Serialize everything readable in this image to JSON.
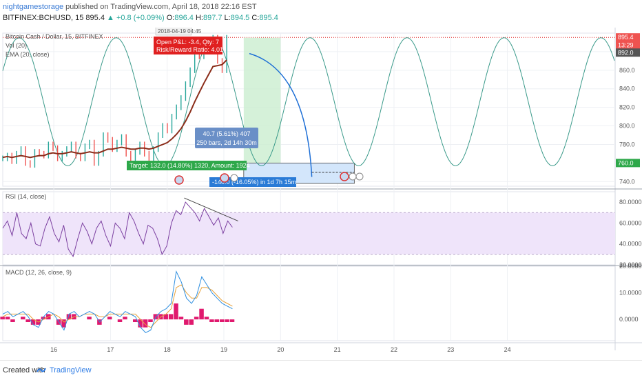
{
  "header": {
    "author": "nightgamestorage",
    "published_text": "published on TradingView.com, April 18, 2018 22:16 EST",
    "symbol": "BITFINEX:BCHUSD, 15",
    "last": "895.4",
    "change": "▲ +0.8 (+0.09%)",
    "o_label": "O:",
    "o_value": "896.4",
    "h_label": "H:",
    "h_value": "897.7",
    "l_label": "L:",
    "l_value": "894.5",
    "c_label": "C:",
    "c_value": "895.4"
  },
  "footer": {
    "created_with": "Created with",
    "brand": "TradingView"
  },
  "chart_data": {
    "type": "line",
    "colors": {
      "ema": "#8b2d1a",
      "price_up": "#26a69a",
      "price_down": "#ef5350",
      "sine": "#3a9a8a",
      "arc": "#1e6fd6",
      "rsi": "#7b3fa0",
      "rsi_band": "#efe4fa",
      "macd": "#2f8fe0",
      "signal": "#e8a23a",
      "hist": "#e0196e",
      "target": "#2ea84a",
      "stop_blue": "#2a7bd6",
      "pnl_red": "#e02020"
    },
    "main": {
      "title": "Bitcoin Cash / Dollar, 15, BITFINEX",
      "indicator_1": "Vol (20)",
      "indicator_2": "EMA (20, close)",
      "y_ticks": [
        "880.0",
        "860.0",
        "840.0",
        "820.0",
        "800.0",
        "780.0",
        "740.0"
      ],
      "price_tags": [
        {
          "label": "895.4",
          "color": "#ef5350"
        },
        {
          "label": "13:29",
          "color": "#ef5350"
        },
        {
          "label": "892.0",
          "color": "#555555"
        },
        {
          "label": "760.0",
          "color": "#2ea84a"
        }
      ],
      "ylim": [
        735,
        900
      ],
      "price_close": [
        765,
        768,
        762,
        770,
        775,
        760,
        758,
        772,
        770,
        768,
        780,
        776,
        765,
        770,
        775,
        780,
        768,
        765,
        778,
        782,
        760,
        770,
        790,
        785,
        775,
        782,
        788,
        770,
        760,
        772,
        780,
        770,
        765,
        775,
        790,
        800,
        795,
        810,
        820,
        830,
        845,
        860,
        880,
        875,
        890,
        885,
        895,
        870,
        860,
        895
      ],
      "ema": [
        766,
        767,
        766,
        767,
        768,
        767,
        766,
        767,
        768,
        768,
        770,
        771,
        770,
        770,
        771,
        772,
        771,
        770,
        771,
        772,
        771,
        771,
        773,
        775,
        775,
        776,
        777,
        776,
        775,
        775,
        776,
        776,
        775,
        776,
        778,
        780,
        782,
        786,
        791,
        797,
        805,
        815,
        826,
        836,
        846,
        855,
        864,
        865,
        866,
        871
      ],
      "sine_crests": [
        "17.1",
        "18.8",
        "21.8",
        "23.5",
        "26.0"
      ],
      "annotations": {
        "timestamp": "2018-04-19 04:45",
        "pnl_line1": "Open P&L: -3.4, Qty: 7",
        "pnl_line2": "Risk/Reward Ratio: 4.01",
        "range_line1": "40.7 (5.61%) 407",
        "range_line2": "250 bars, 2d 14h 30m",
        "target": "Target: 132.0 (14.80%) 1320, Amount: 1924",
        "stop": "-140.0 (-16.05%) in 1d 7h 15m"
      }
    },
    "rsi": {
      "title": "RSI (14, close)",
      "y_ticks": [
        "80.0000",
        "60.0000",
        "40.0000",
        "20.0000"
      ],
      "ylim": [
        20,
        90
      ],
      "upper": 70,
      "lower": 30,
      "values": [
        55,
        62,
        48,
        70,
        50,
        45,
        60,
        40,
        38,
        55,
        66,
        50,
        42,
        58,
        35,
        28,
        45,
        60,
        52,
        40,
        55,
        62,
        48,
        38,
        60,
        55,
        45,
        70,
        62,
        50,
        40,
        58,
        55,
        45,
        30,
        38,
        60,
        72,
        68,
        80,
        75,
        70,
        62,
        74,
        66,
        58,
        65,
        50,
        62,
        56
      ]
    },
    "macd": {
      "title": "MACD (12, 26, close, 9)",
      "y_ticks": [
        "20.0000",
        "10.0000",
        "0.0000"
      ],
      "ylim": [
        -8,
        20
      ],
      "macd": [
        2,
        3,
        1,
        2,
        3,
        1,
        -2,
        -3,
        1,
        3,
        2,
        -1,
        -4,
        2,
        3,
        1,
        2,
        3,
        2,
        -1,
        1,
        3,
        2,
        1,
        3,
        2,
        1,
        -3,
        -5,
        -4,
        1,
        3,
        4,
        6,
        18,
        14,
        8,
        6,
        9,
        16,
        13,
        10,
        8,
        6,
        5,
        4
      ],
      "signal": [
        1,
        2,
        2,
        2,
        2,
        2,
        0,
        -1,
        0,
        1,
        2,
        1,
        -1,
        0,
        1,
        1,
        2,
        2,
        2,
        1,
        1,
        2,
        2,
        2,
        2,
        2,
        2,
        0,
        -2,
        -3,
        -1,
        1,
        2,
        4,
        12,
        13,
        10,
        8,
        8,
        12,
        12,
        11,
        9,
        7,
        6,
        5
      ],
      "hist": [
        1,
        1,
        -1,
        0,
        1,
        -1,
        -2,
        -2,
        1,
        2,
        0,
        -2,
        -3,
        2,
        2,
        0,
        0,
        1,
        0,
        -2,
        0,
        1,
        0,
        -1,
        1,
        0,
        -1,
        -3,
        -3,
        -1,
        2,
        2,
        2,
        2,
        6,
        1,
        -2,
        -2,
        1,
        4,
        1,
        -1,
        -1,
        -1,
        -1,
        -1
      ]
    },
    "x_axis": {
      "ticks": [
        "16",
        "17",
        "18",
        "19",
        "20",
        "21",
        "22",
        "23",
        "24"
      ],
      "xlim": [
        15.1,
        25.9
      ]
    }
  }
}
